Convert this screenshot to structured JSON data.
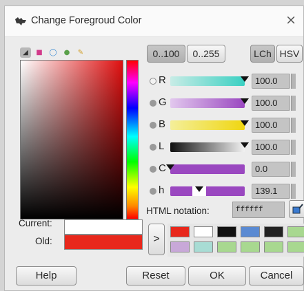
{
  "window": {
    "title": "Change Foregroud Color",
    "close_glyph": "×"
  },
  "selector_tabs": [
    {
      "icon": "gimp-selector-icon",
      "glyph": "◢",
      "color": "#3a3a3a"
    },
    {
      "icon": "cmyk-selector-icon",
      "glyph": "■",
      "color": "#d23a8a"
    },
    {
      "icon": "wheel-selector-icon",
      "glyph": "◯",
      "color": "#3a8ad2"
    },
    {
      "icon": "watercolor-selector-icon",
      "glyph": "●",
      "color": "#5aa04a"
    },
    {
      "icon": "palette-selector-icon",
      "glyph": "✎",
      "color": "#d2a02a"
    }
  ],
  "range_buttons": {
    "range_100": "0..100",
    "range_255": "0..255"
  },
  "model_buttons": {
    "lch": "LCh",
    "hsv": "HSV"
  },
  "channels": [
    {
      "label": "R",
      "value": "100.0",
      "level": 1.0,
      "colors": [
        "#c8ece6",
        "#3ad0c2"
      ]
    },
    {
      "label": "G",
      "value": "100.0",
      "level": 1.0,
      "colors": [
        "#e2c8ee",
        "#9a48c0"
      ]
    },
    {
      "label": "B",
      "value": "100.0",
      "level": 1.0,
      "colors": [
        "#f4ef9a",
        "#f0d610"
      ]
    },
    {
      "label": "L",
      "value": "100.0",
      "level": 1.0,
      "colors": [
        "#111111",
        "#f2f2f2"
      ]
    },
    {
      "label": "C",
      "value": "0.0",
      "level": 0.0,
      "colors": [
        "#9a48c0",
        "#9a48c0"
      ]
    },
    {
      "label": "h",
      "value": "139.1",
      "level": 0.386,
      "colors": [
        "#9a48c0",
        "#9a48c0"
      ]
    }
  ],
  "html_notation": {
    "label": "HTML notation:",
    "value": "ffffff"
  },
  "current": {
    "label": "Current:",
    "color": "#ffffff"
  },
  "old": {
    "label": "Old:",
    "color": "#e8281c"
  },
  "history_arrow": ">",
  "history": {
    "row1": [
      "#e8281c",
      "#ffffff",
      "#111111",
      "#5a8ad2",
      "#222222",
      "#a8d890"
    ],
    "row2": [
      "#c8a8d8",
      "#a8dcd4",
      "#a8d890",
      "#a8d890",
      "#a8d890",
      "#a8d890"
    ]
  },
  "buttons": {
    "help": "Help",
    "reset": "Reset",
    "ok": "OK",
    "cancel": "Cancel"
  }
}
